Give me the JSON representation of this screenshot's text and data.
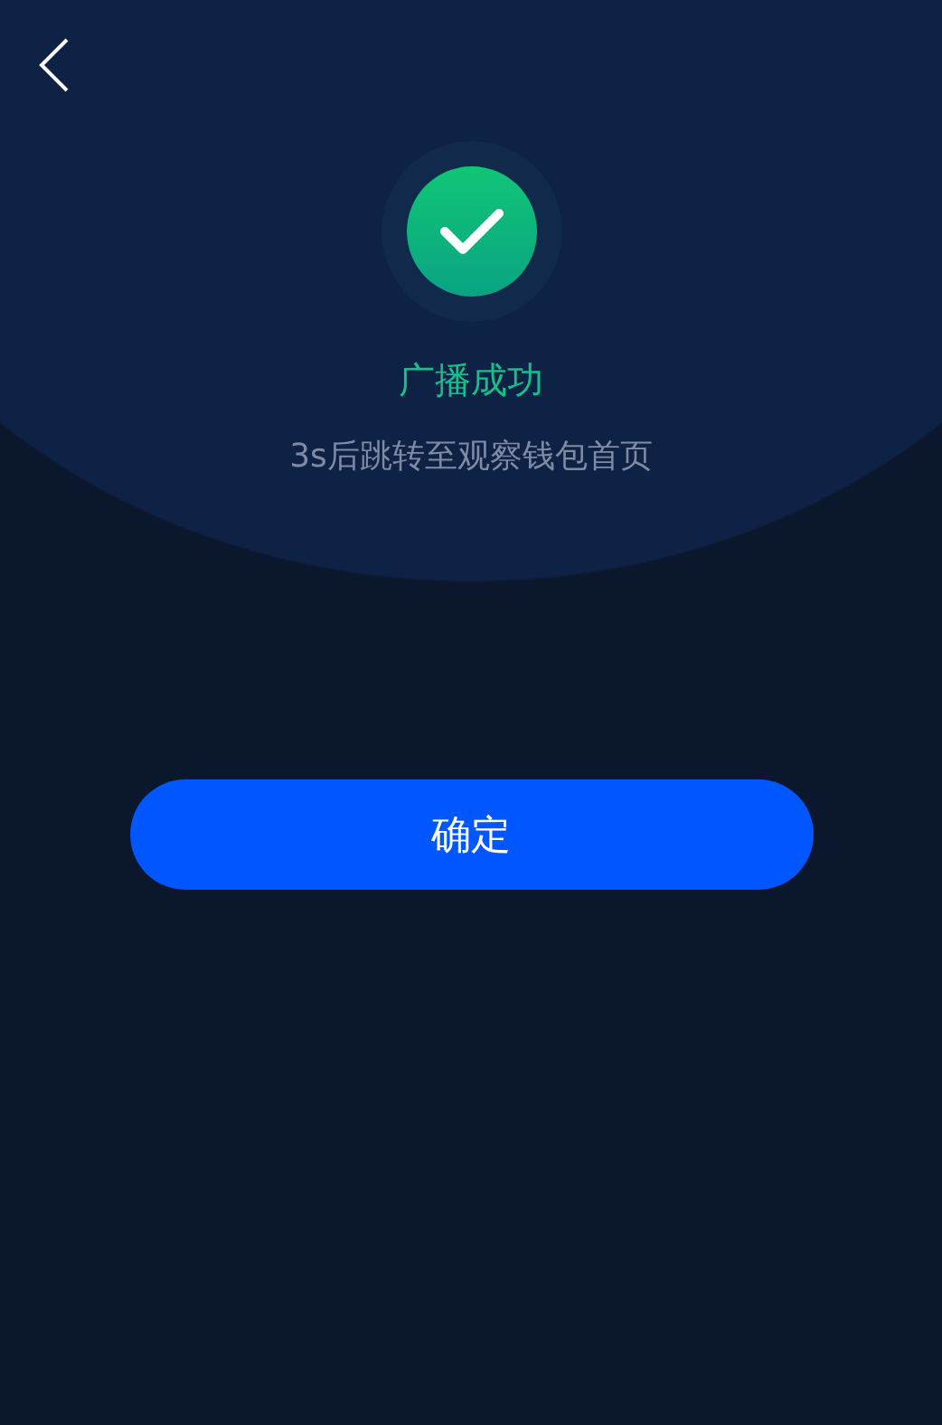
{
  "status": {
    "title": "广播成功",
    "message": "3s后跳转至观察钱包首页"
  },
  "button": {
    "label": "确定"
  }
}
